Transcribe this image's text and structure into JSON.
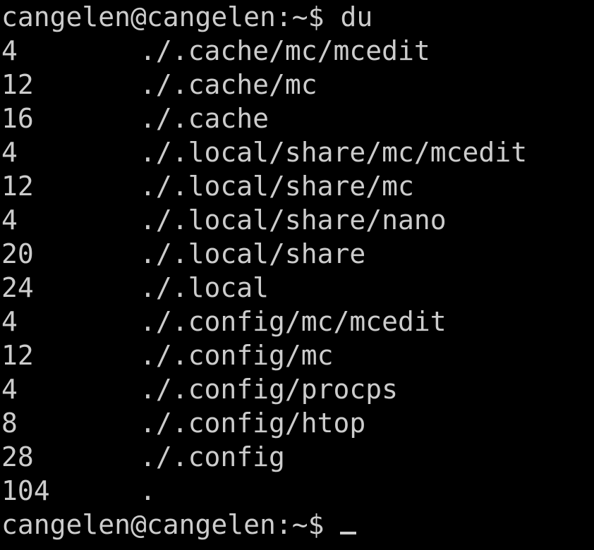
{
  "terminal": {
    "command_line": {
      "prompt": "cangelen@cangelen:~$ ",
      "command": "du"
    },
    "rows": [
      {
        "size": "4",
        "path": "./.cache/mc/mcedit"
      },
      {
        "size": "12",
        "path": "./.cache/mc"
      },
      {
        "size": "16",
        "path": "./.cache"
      },
      {
        "size": "4",
        "path": "./.local/share/mc/mcedit"
      },
      {
        "size": "12",
        "path": "./.local/share/mc"
      },
      {
        "size": "4",
        "path": "./.local/share/nano"
      },
      {
        "size": "20",
        "path": "./.local/share"
      },
      {
        "size": "24",
        "path": "./.local"
      },
      {
        "size": "4",
        "path": "./.config/mc/mcedit"
      },
      {
        "size": "12",
        "path": "./.config/mc"
      },
      {
        "size": "4",
        "path": "./.config/procps"
      },
      {
        "size": "8",
        "path": "./.config/htop"
      },
      {
        "size": "28",
        "path": "./.config"
      },
      {
        "size": "104",
        "path": "."
      }
    ],
    "final_prompt": "cangelen@cangelen:~$ ",
    "colors": {
      "background": "#000000",
      "foreground": "#cccccc"
    }
  }
}
